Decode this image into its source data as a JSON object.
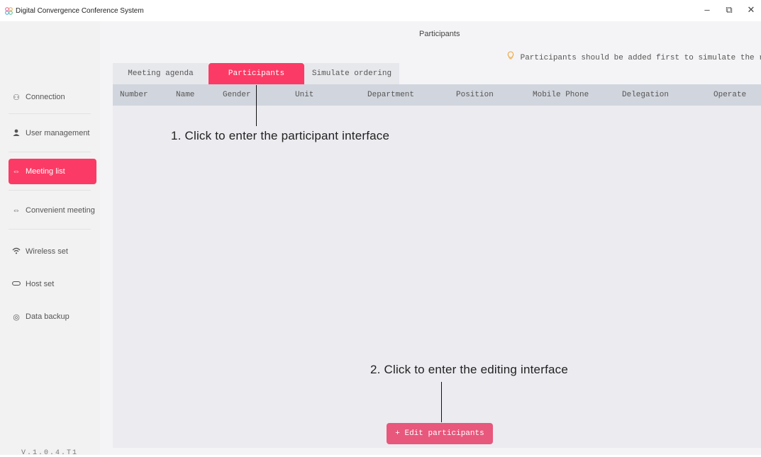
{
  "app": {
    "title": "Digital Convergence Conference System",
    "window_controls": {
      "minimize": "–",
      "restore": "⧉",
      "close": "✕"
    }
  },
  "sidebar": {
    "items": [
      {
        "label": "Connection",
        "icon": "connection-icon",
        "glyph": "⚇",
        "active": false
      },
      {
        "label": "User management",
        "icon": "user-icon",
        "glyph": "👤",
        "active": false
      },
      {
        "label": "Meeting list",
        "icon": "meeting-icon",
        "glyph": "⇔",
        "active": true
      },
      {
        "label": "Convenient meeting",
        "icon": "meeting-icon",
        "glyph": "⇔",
        "active": false
      },
      {
        "label": "Wireless set",
        "icon": "wifi-icon",
        "glyph": "ᯤ",
        "active": false
      },
      {
        "label": "Host set",
        "icon": "host-icon",
        "glyph": "▭",
        "active": false
      },
      {
        "label": "Data backup",
        "icon": "backup-icon",
        "glyph": "◎",
        "active": false
      }
    ],
    "version": "V.1.0.4.T1",
    "accent": "#fb3b65"
  },
  "page": {
    "title": "Participants",
    "notice": "Participants should be added first to simulate the ranking",
    "notice_icon": "lightbulb-icon"
  },
  "tabs": [
    {
      "label": "Meeting agenda",
      "active": false
    },
    {
      "label": "Participants",
      "active": true
    },
    {
      "label": "Simulate ordering",
      "active": false
    }
  ],
  "table": {
    "columns": [
      "Number",
      "Name",
      "Gender",
      "Unit",
      "Department",
      "Position",
      "Mobile Phone",
      "Delegation",
      "Operate"
    ]
  },
  "annotations": {
    "step1": "1. Click to enter the participant interface",
    "step2": "2. Click to enter the editing interface"
  },
  "actions": {
    "edit_participants": "+ Edit participants"
  }
}
